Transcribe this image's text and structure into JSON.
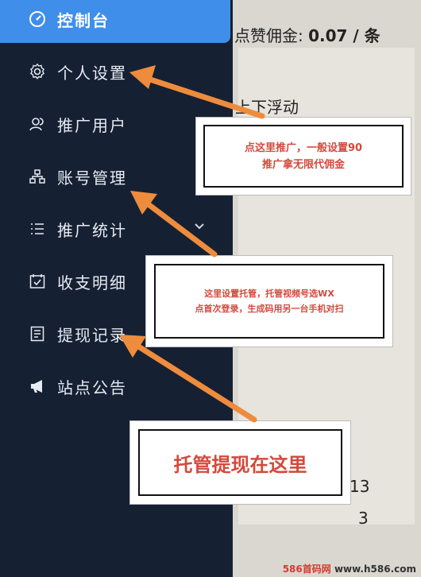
{
  "sidebar": {
    "items": [
      {
        "label": "控制台",
        "icon": "dashboard-icon"
      },
      {
        "label": "个人设置",
        "icon": "gear-icon"
      },
      {
        "label": "推广用户",
        "icon": "users-icon"
      },
      {
        "label": "账号管理",
        "icon": "org-chart-icon"
      },
      {
        "label": "推广统计",
        "icon": "list-icon"
      },
      {
        "label": "收支明细",
        "icon": "calendar-check-icon"
      },
      {
        "label": "提现记录",
        "icon": "document-list-icon"
      },
      {
        "label": "站点公告",
        "icon": "megaphone-icon"
      }
    ],
    "expand_icon": "chevron-down-icon"
  },
  "background": {
    "like_commission_label": "点赞佣金:",
    "like_commission_value": "0.07 / 条",
    "float_text": "上下浮动",
    "number_1": "13",
    "number_2": "3"
  },
  "annotations": {
    "note_1": "点这里推广，一般设置90\n推广拿无限代佣金",
    "note_2": "这里设置托管，托管视频号选WX\n点首次登录，生成码用另一台手机对扫",
    "note_3": "托管提现在这里"
  },
  "watermark": {
    "brand": "586首码网",
    "url": "www.h586.com"
  },
  "colors": {
    "sidebar_bg": "#162033",
    "active_bg": "#3f8ee9",
    "arrow": "#ee8c3d",
    "note_text": "#d24a3c"
  }
}
